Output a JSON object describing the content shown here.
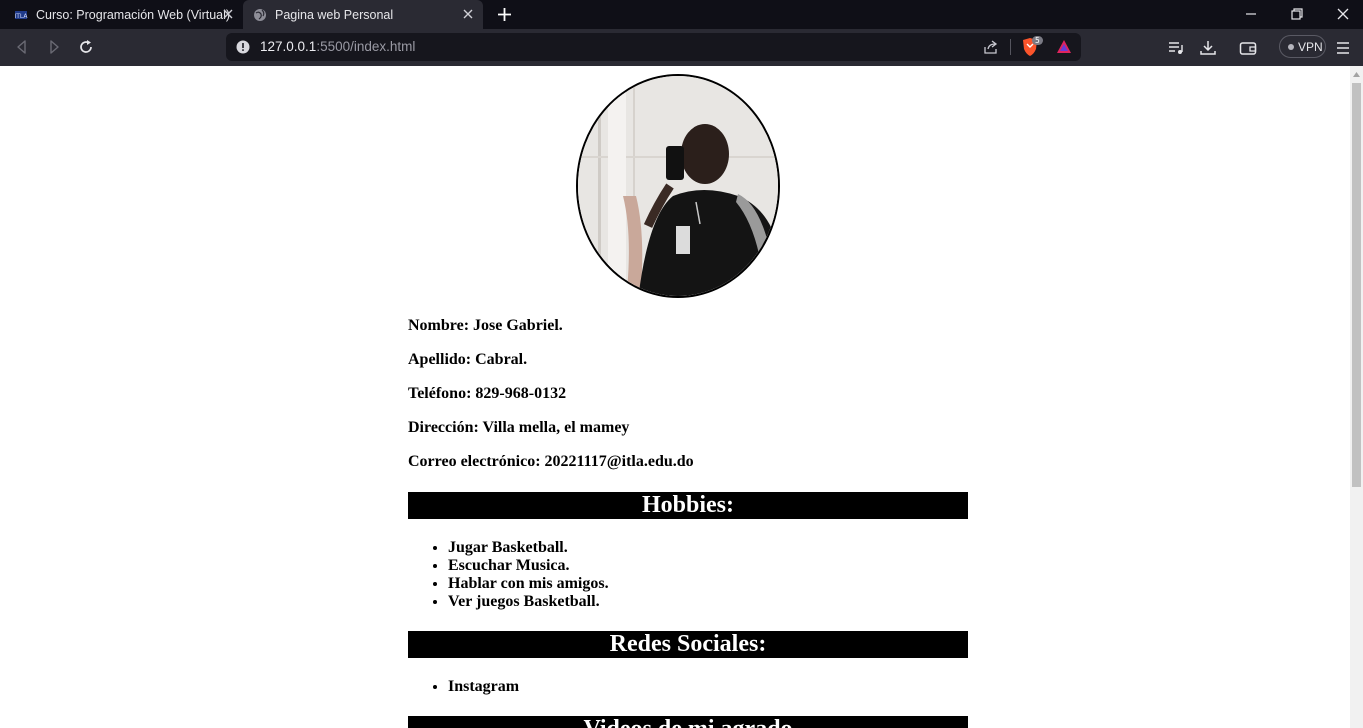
{
  "tabs": [
    {
      "title": "Curso: Programación Web (Virtual) ",
      "active": false
    },
    {
      "title": "Pagina web Personal",
      "active": true
    }
  ],
  "toolbar": {
    "url_host": "127.0.0.1",
    "url_rest": ":5500/index.html",
    "shield_count": "5",
    "vpn_label": "VPN"
  },
  "profile": {
    "nombre": "Nombre: Jose Gabriel.",
    "apellido": "Apellido: Cabral.",
    "telefono": "Teléfono: 829-968-0132",
    "direccion": "Dirección: Villa mella, el mamey",
    "correo": "Correo electrónico: 20221117@itla.edu.do"
  },
  "hobbies": {
    "heading": "Hobbies:",
    "items": [
      "Jugar Basketball.",
      "Escuchar Musica.",
      "Hablar con mis amigos.",
      "Ver juegos Basketball."
    ]
  },
  "redes": {
    "heading": "Redes Sociales:",
    "items": [
      "Instagram"
    ]
  },
  "videos": {
    "heading": "Videos de mi agrado"
  },
  "icons": {
    "tab_inactive_favicon": "itla-logo-icon",
    "tab_active_favicon": "globe-icon",
    "back": "back-icon",
    "forward": "forward-icon",
    "reload": "reload-icon",
    "info": "info-icon",
    "share": "share-icon",
    "shield": "brave-shield-icon",
    "rewards": "brave-rewards-icon",
    "playlist": "playlist-icon",
    "downloads": "download-icon",
    "wallet": "wallet-icon",
    "menu": "hamburger-menu-icon"
  },
  "colors": {
    "tab_strip": "#0f0f17",
    "toolbar": "#2a2a33",
    "banner_bg": "#000000",
    "banner_text": "#ffffff"
  }
}
